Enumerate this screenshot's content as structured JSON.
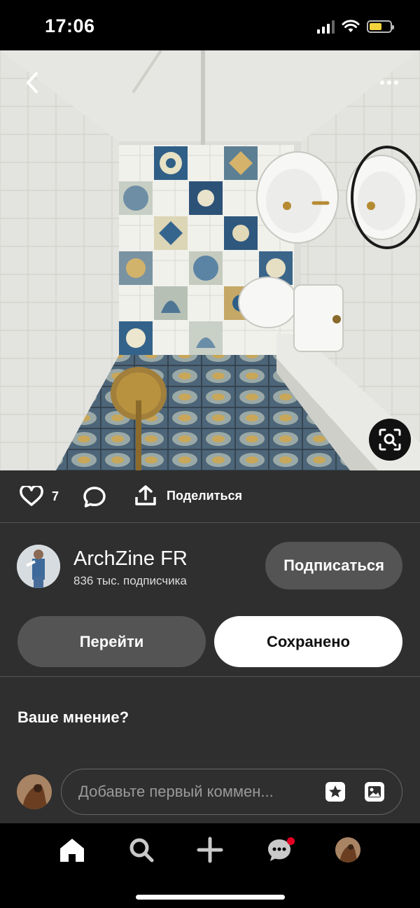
{
  "status_bar": {
    "time": "17:06",
    "icons": [
      "cellular-signal-icon",
      "wifi-icon",
      "battery-icon"
    ],
    "battery_color": "#f4d23b"
  },
  "hero": {
    "icons": [
      "back-chevron-icon",
      "more-dots-icon",
      "visual-search-icon"
    ]
  },
  "actions": {
    "like_count": "7",
    "share_label": "Поделиться",
    "icons": [
      "heart-icon",
      "comment-bubble-icon",
      "share-upload-icon"
    ]
  },
  "creator": {
    "name": "ArchZine FR",
    "followers": "836 тыс. подписчика",
    "follow_label": "Подписаться"
  },
  "buttons": {
    "visit_label": "Перейти",
    "saved_label": "Сохранено"
  },
  "comments": {
    "title": "Ваше мнение?",
    "placeholder": "Добавьте первый коммен...",
    "icons": [
      "sticker-icon",
      "image-icon"
    ]
  },
  "tabbar": {
    "icons": [
      "home-icon",
      "search-icon",
      "plus-icon",
      "messages-icon",
      "profile-avatar"
    ],
    "notification_color": "#e60023"
  },
  "colors": {
    "panel_bg": "#2f2f2f",
    "button_gray": "#545454",
    "saved_bg": "#ffffff"
  }
}
